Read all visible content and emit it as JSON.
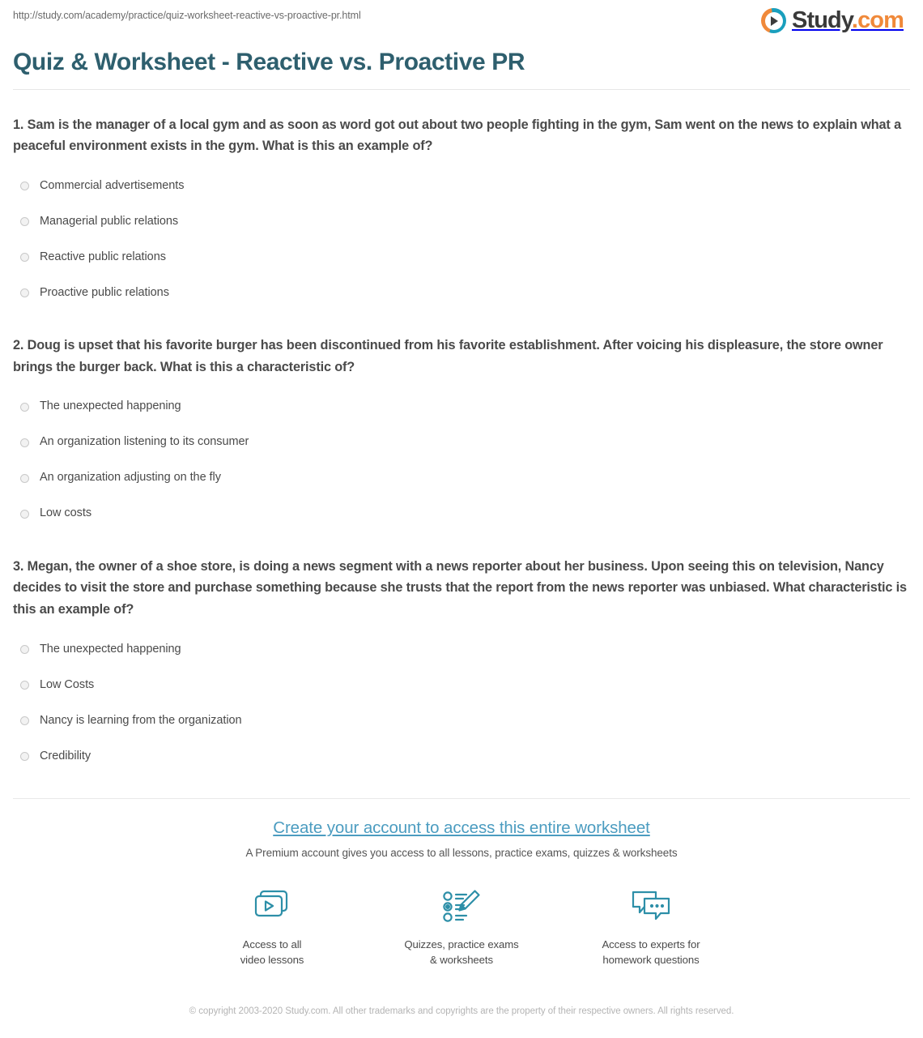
{
  "header": {
    "url": "http://study.com/academy/practice/quiz-worksheet-reactive-vs-proactive-pr.html",
    "brand_name": "Study",
    "brand_suffix": ".com",
    "brand_dot_color": "#f0893a",
    "brand_ring_orange": "#f0893a",
    "brand_ring_teal": "#1a9fbd"
  },
  "page_title": "Quiz & Worksheet - Reactive vs. Proactive PR",
  "title_color": "#2e5f6e",
  "questions": [
    {
      "text": "1. Sam is the manager of a local gym and as soon as word got out about two people fighting in the gym, Sam went on the news to explain what a peaceful environment exists in the gym. What is this an example of?",
      "options": [
        "Commercial advertisements",
        "Managerial public relations",
        "Reactive public relations",
        "Proactive public relations"
      ]
    },
    {
      "text": "2. Doug is upset that his favorite burger has been discontinued from his favorite establishment. After voicing his displeasure, the store owner brings the burger back. What is this a characteristic of?",
      "options": [
        "The unexpected happening",
        "An organization listening to its consumer",
        "An organization adjusting on the fly",
        "Low costs"
      ]
    },
    {
      "text": "3. Megan, the owner of a shoe store, is doing a news segment with a news reporter about her business. Upon seeing this on television, Nancy decides to visit the store and purchase something because she trusts that the report from the news reporter was unbiased. What characteristic is this an example of?",
      "options": [
        "The unexpected happening",
        "Low Costs",
        "Nancy is learning from the organization",
        "Credibility"
      ]
    }
  ],
  "cta": {
    "heading": "Create your account to access this entire worksheet",
    "heading_color": "#4b9cc0",
    "subheading": "A Premium account gives you access to all lessons, practice exams, quizzes & worksheets",
    "features": [
      {
        "icon": "video-lessons-icon",
        "label": "Access to all\nvideo lessons"
      },
      {
        "icon": "quiz-worksheet-icon",
        "label": "Quizzes, practice exams\n& worksheets"
      },
      {
        "icon": "chat-bubbles-icon",
        "label": "Access to experts for\nhomework questions"
      }
    ],
    "icon_color": "#2d8fa8"
  },
  "copyright": "© copyright 2003-2020 Study.com. All other trademarks and copyrights are the property of their respective owners. All rights reserved."
}
